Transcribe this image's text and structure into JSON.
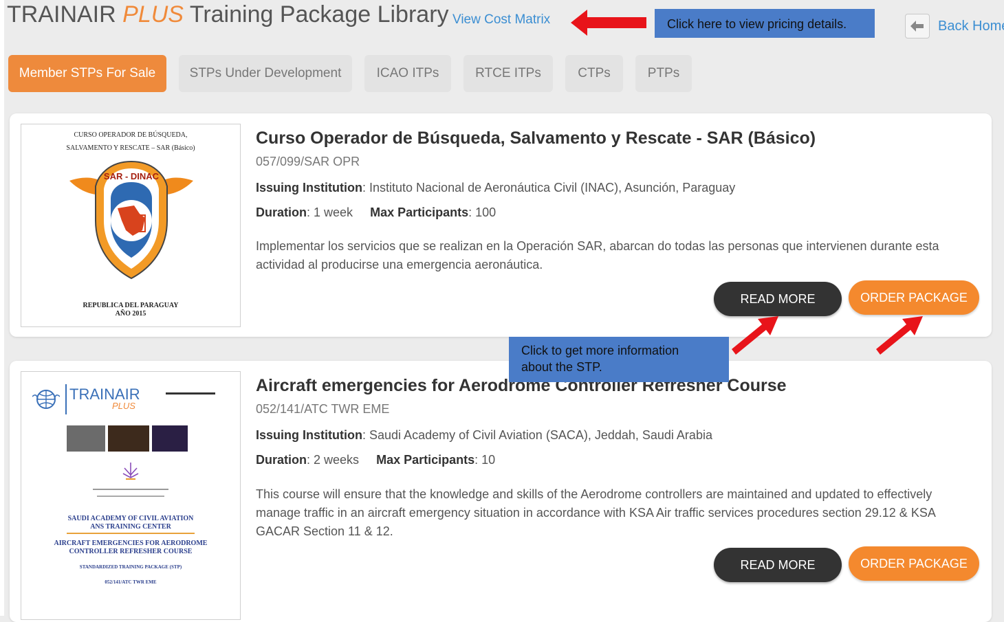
{
  "header": {
    "title_prefix": "TRAINAIR",
    "title_plus": "PLUS",
    "title_suffix": "Training Package Library",
    "cost_link": "View Cost Matrix",
    "pricing_callout": "Click here to view pricing details.",
    "back_home": "Back Home"
  },
  "tabs": [
    {
      "label": "Member STPs For Sale",
      "active": true
    },
    {
      "label": "STPs Under Development",
      "active": false
    },
    {
      "label": "ICAO ITPs",
      "active": false
    },
    {
      "label": "RTCE ITPs",
      "active": false
    },
    {
      "label": "CTPs",
      "active": false
    },
    {
      "label": "PTPs",
      "active": false
    }
  ],
  "info_callout": {
    "line1": "Click to get more information",
    "line2": "about the STP."
  },
  "labels": {
    "issuing_institution": "Issuing Institution",
    "duration": "Duration",
    "max_participants": "Max Participants",
    "read_more": "READ MORE",
    "order_package": "ORDER PACKAGE"
  },
  "packages": [
    {
      "title": "Curso Operador de Búsqueda, Salvamento y Rescate - SAR (Básico)",
      "code": "057/099/SAR OPR",
      "institution": "Instituto Nacional de Aeronáutica Civil (INAC), Asunción, Paraguay",
      "duration": "1 week",
      "max_participants": "100",
      "description": "Implementar los servicios que se realizan en la Operación SAR, abarcan do todas las personas que intervienen durante esta actividad al producirse una emergencia aeronáutica.",
      "cover": {
        "line1": "CURSO OPERADOR DE BÚSQUEDA,",
        "line2": "SALVAMENTO Y RESCATE – SAR (Básico)",
        "badge": "SAR - DINAC",
        "footer1": "REPUBLICA DEL PARAGUAY",
        "footer2": "AÑO 2015"
      }
    },
    {
      "title": "Aircraft emergencies for Aerodrome Controller Refresher Course",
      "code": "052/141/ATC TWR EME",
      "institution": "Saudi Academy of Civil Aviation (SACA), Jeddah, Saudi Arabia",
      "duration": "2 weeks",
      "max_participants": "10",
      "description": "This course will ensure that the knowledge and skills of the Aerodrome controllers are maintained and updated to effectively manage traffic in an aircraft emergency situation in accordance with KSA Air traffic services procedures section 29.12 & KSA GACAR Section 11 & 12.",
      "cover": {
        "brand": "TRAINAIR",
        "brand_plus": "PLUS",
        "academy1": "SAUDI ACADEMY OF CIVIL AVIATION",
        "academy2": "ANS TRAINING CENTER",
        "course1": "AIRCRAFT EMERGENCIES FOR AERODROME",
        "course2": "CONTROLLER REFRESHER COURSE",
        "stp": "STANDARDIZED TRAINING PACKAGE (STP)",
        "code": "052/141/ATC TWR EME"
      }
    }
  ],
  "colors": {
    "accent_orange": "#f4892e",
    "link_blue": "#3b8ed2",
    "callout_blue": "#4a7cc8",
    "annotation_red": "#e8141a"
  }
}
